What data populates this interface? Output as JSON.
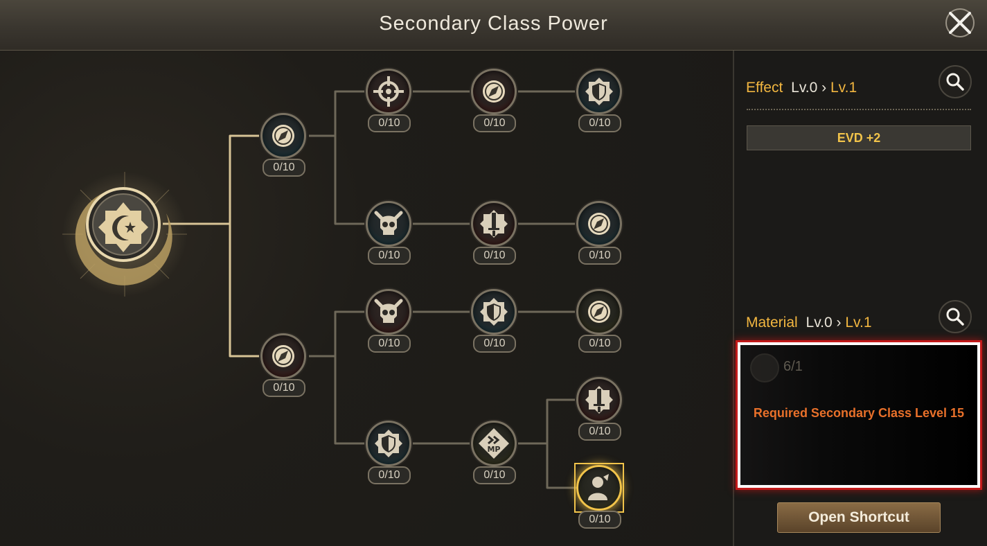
{
  "header": {
    "title": "Secondary Class Power"
  },
  "tree": {
    "nodes": [
      {
        "id": "b1",
        "icon": "compass-icon",
        "level": "0/10"
      },
      {
        "id": "b2",
        "icon": "compass-icon",
        "level": "0/10"
      },
      {
        "id": "r1c1",
        "icon": "crosshair-icon",
        "level": "0/10"
      },
      {
        "id": "r1c2",
        "icon": "compass-icon",
        "level": "0/10"
      },
      {
        "id": "r1c3",
        "icon": "shield-icon",
        "level": "0/10"
      },
      {
        "id": "r2c1",
        "icon": "skull-icon",
        "level": "0/10"
      },
      {
        "id": "r2c2",
        "icon": "sword-icon",
        "level": "0/10"
      },
      {
        "id": "r2c3",
        "icon": "compass-icon",
        "level": "0/10"
      },
      {
        "id": "r3c1",
        "icon": "skull-icon",
        "level": "0/10"
      },
      {
        "id": "r3c2",
        "icon": "shield-icon",
        "level": "0/10"
      },
      {
        "id": "r3c3",
        "icon": "compass-icon",
        "level": "0/10"
      },
      {
        "id": "r4c3",
        "icon": "sword-icon",
        "level": "0/10"
      },
      {
        "id": "r5c1",
        "icon": "shield-icon",
        "level": "0/10"
      },
      {
        "id": "r5c2",
        "icon": "mp-icon",
        "level": "0/10"
      },
      {
        "id": "r5c3",
        "icon": "person-icon",
        "level": "0/10"
      }
    ]
  },
  "effect": {
    "label": "Effect",
    "from_level": "Lv.0",
    "arrow": "›",
    "to_level": "Lv.1",
    "value": "EVD +2"
  },
  "material": {
    "label": "Material",
    "from_level": "Lv.0",
    "arrow": "›",
    "to_level": "Lv.1",
    "item_count": "6/1",
    "requirement": "Required Secondary Class Level 15"
  },
  "buttons": {
    "shortcut": "Open Shortcut"
  },
  "colors": {
    "accent": "#f2b640",
    "warning": "#e8702a",
    "highlight_border": "#c21a1a"
  }
}
